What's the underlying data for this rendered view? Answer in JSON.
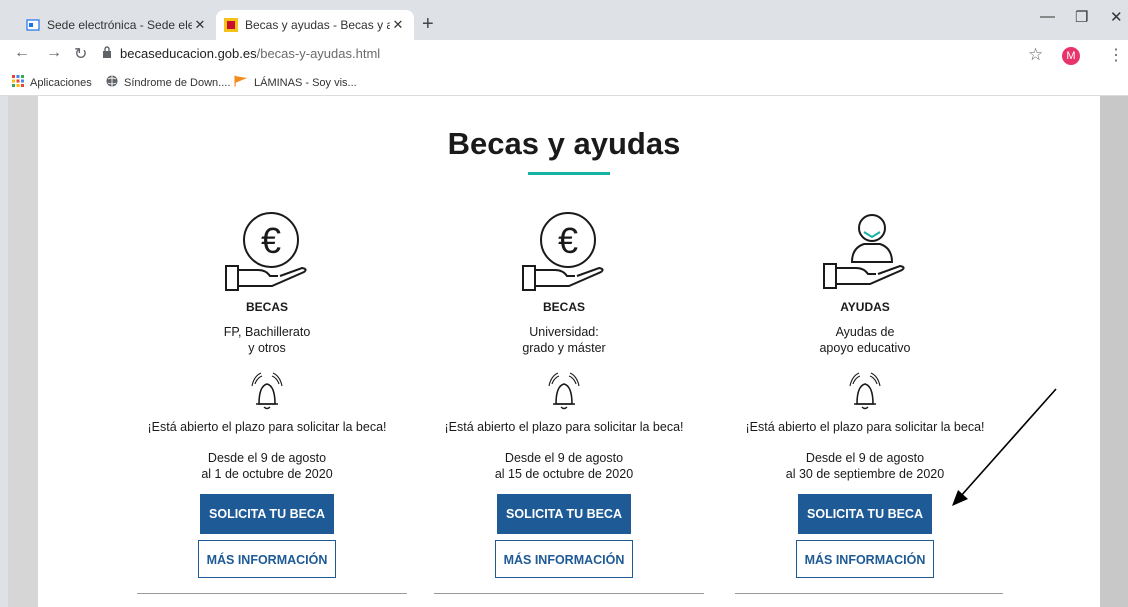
{
  "browser": {
    "tabs": [
      {
        "title": "Sede electrónica - Sede electrónic",
        "close": "✕"
      },
      {
        "title": "Becas y ayudas - Becas y ayudas",
        "close": "✕"
      }
    ],
    "new_tab": "+",
    "url_host": "becaseducacion.gob.es",
    "url_path": "/becas-y-ayudas.html",
    "avatar_initial": "M",
    "bookmarks": [
      "Aplicaciones",
      "Síndrome de Down....",
      "LÁMINAS - Soy vis..."
    ]
  },
  "page": {
    "title": "Becas y ayudas",
    "accent_color": "#16b2a6",
    "button_color": "#1e5a96",
    "cards": [
      {
        "kind": "BECAS",
        "desc_line1": "FP, Bachillerato",
        "desc_line2": "y otros",
        "open_text": "¡Está abierto el plazo para solicitar la beca!",
        "date_line1": "Desde el 9 de agosto",
        "date_line2": "al 1 de octubre de 2020",
        "primary": "SOLICITA TU BECA",
        "secondary": "MÁS INFORMACIÓN",
        "icon": "euro-hand-icon"
      },
      {
        "kind": "BECAS",
        "desc_line1": "Universidad:",
        "desc_line2": "grado y máster",
        "open_text": "¡Está abierto el plazo para solicitar la beca!",
        "date_line1": "Desde el 9 de agosto",
        "date_line2": "al 15 de octubre de 2020",
        "primary": "SOLICITA TU BECA",
        "secondary": "MÁS INFORMACIÓN",
        "icon": "euro-hand-icon"
      },
      {
        "kind": "AYUDAS",
        "desc_line1": "Ayudas de",
        "desc_line2": "apoyo educativo",
        "open_text": "¡Está abierto el plazo para solicitar la beca!",
        "date_line1": "Desde el 9 de agosto",
        "date_line2": "al 30 de septiembre de 2020",
        "primary": "SOLICITA TU BECA",
        "secondary": "MÁS INFORMACIÓN",
        "icon": "person-hand-icon"
      }
    ]
  }
}
